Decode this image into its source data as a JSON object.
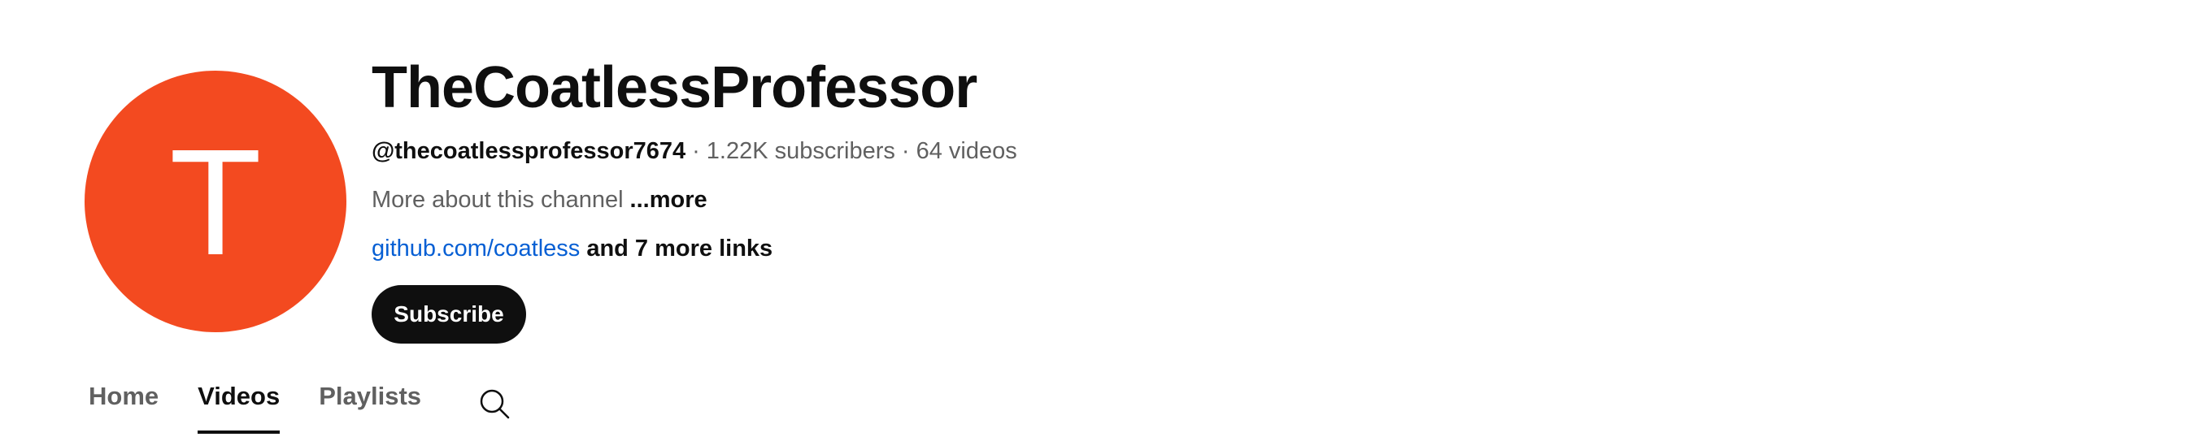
{
  "channel": {
    "avatar_letter": "T",
    "avatar_color": "#f34a20",
    "name": "TheCoatlessProfessor",
    "handle": "@thecoatlessprofessor7674",
    "separator": "·",
    "subscribers": "1.22K subscribers",
    "videos": "64 videos",
    "description": "More about this channel",
    "more_label": "...more",
    "primary_link": "github.com/coatless",
    "more_links": "and 7 more links",
    "subscribe_label": "Subscribe"
  },
  "tabs": [
    {
      "label": "Home",
      "active": false
    },
    {
      "label": "Videos",
      "active": true
    },
    {
      "label": "Playlists",
      "active": false
    }
  ],
  "icons": {
    "search": "search-icon"
  },
  "colors": {
    "text_primary": "#0f0f0f",
    "text_secondary": "#606060",
    "link": "#065fd4",
    "button_bg": "#0f0f0f",
    "button_text": "#ffffff"
  }
}
